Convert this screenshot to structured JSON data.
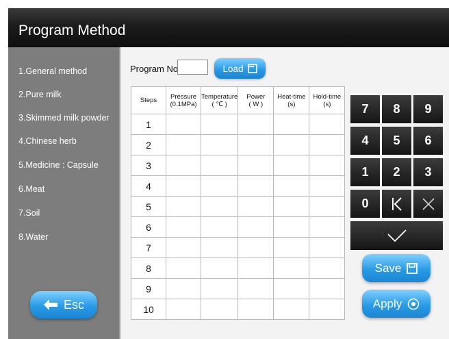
{
  "window": {
    "title": "Program Method"
  },
  "sidebar": {
    "items": [
      {
        "label": "1.General method"
      },
      {
        "label": "2.Pure milk"
      },
      {
        "label": "3.Skimmed milk powder"
      },
      {
        "label": "4.Chinese herb"
      },
      {
        "label": "5.Medicine : Capsule"
      },
      {
        "label": "6.Meat"
      },
      {
        "label": "7.Soil"
      },
      {
        "label": "8.Water"
      }
    ],
    "esc_label": "Esc"
  },
  "program": {
    "label": "Program No.",
    "value": "",
    "load_label": "Load"
  },
  "table": {
    "headers": [
      {
        "line1": "Steps",
        "line2": ""
      },
      {
        "line1": "Pressure",
        "line2": "(0.1MPa)"
      },
      {
        "line1": "Temperature",
        "line2": "( ℃ )"
      },
      {
        "line1": "Power",
        "line2": "( W )"
      },
      {
        "line1": "Heat-time",
        "line2": "(s)"
      },
      {
        "line1": "Hold-time",
        "line2": "(s)"
      }
    ],
    "rows": [
      {
        "step": "1",
        "pressure": "",
        "temperature": "",
        "power": "",
        "heat_time": "",
        "hold_time": ""
      },
      {
        "step": "2",
        "pressure": "",
        "temperature": "",
        "power": "",
        "heat_time": "",
        "hold_time": ""
      },
      {
        "step": "3",
        "pressure": "",
        "temperature": "",
        "power": "",
        "heat_time": "",
        "hold_time": ""
      },
      {
        "step": "4",
        "pressure": "",
        "temperature": "",
        "power": "",
        "heat_time": "",
        "hold_time": ""
      },
      {
        "step": "5",
        "pressure": "",
        "temperature": "",
        "power": "",
        "heat_time": "",
        "hold_time": ""
      },
      {
        "step": "6",
        "pressure": "",
        "temperature": "",
        "power": "",
        "heat_time": "",
        "hold_time": ""
      },
      {
        "step": "7",
        "pressure": "",
        "temperature": "",
        "power": "",
        "heat_time": "",
        "hold_time": ""
      },
      {
        "step": "8",
        "pressure": "",
        "temperature": "",
        "power": "",
        "heat_time": "",
        "hold_time": ""
      },
      {
        "step": "9",
        "pressure": "",
        "temperature": "",
        "power": "",
        "heat_time": "",
        "hold_time": ""
      },
      {
        "step": "10",
        "pressure": "",
        "temperature": "",
        "power": "",
        "heat_time": "",
        "hold_time": ""
      }
    ]
  },
  "keypad": {
    "keys": [
      "7",
      "8",
      "9",
      "4",
      "5",
      "6",
      "1",
      "2",
      "3",
      "0"
    ],
    "backspace_icon": "backspace-icon",
    "clear_icon": "close-icon",
    "confirm_icon": "checkmark-icon"
  },
  "actions": {
    "save_label": "Save",
    "apply_label": "Apply"
  },
  "colors": {
    "title_bar": "#1c1c1c",
    "sidebar": "#7d7d7d",
    "button_blue": "#2a9be6",
    "key_dark": "#151515"
  }
}
